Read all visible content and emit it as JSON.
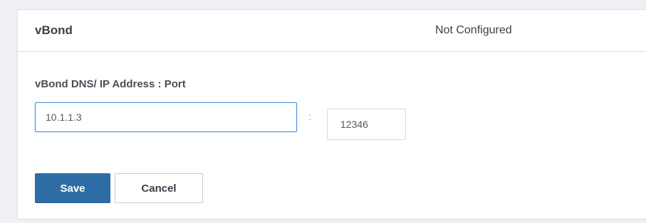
{
  "panel": {
    "title": "vBond",
    "status": "Not Configured"
  },
  "form": {
    "label": "vBond DNS/ IP Address : Port",
    "ip_value": "10.1.1.3",
    "separator": ":",
    "port_value": "12346"
  },
  "actions": {
    "save_label": "Save",
    "cancel_label": "Cancel"
  },
  "colors": {
    "primary": "#2e6da4",
    "focus_border": "#4a90d9"
  }
}
